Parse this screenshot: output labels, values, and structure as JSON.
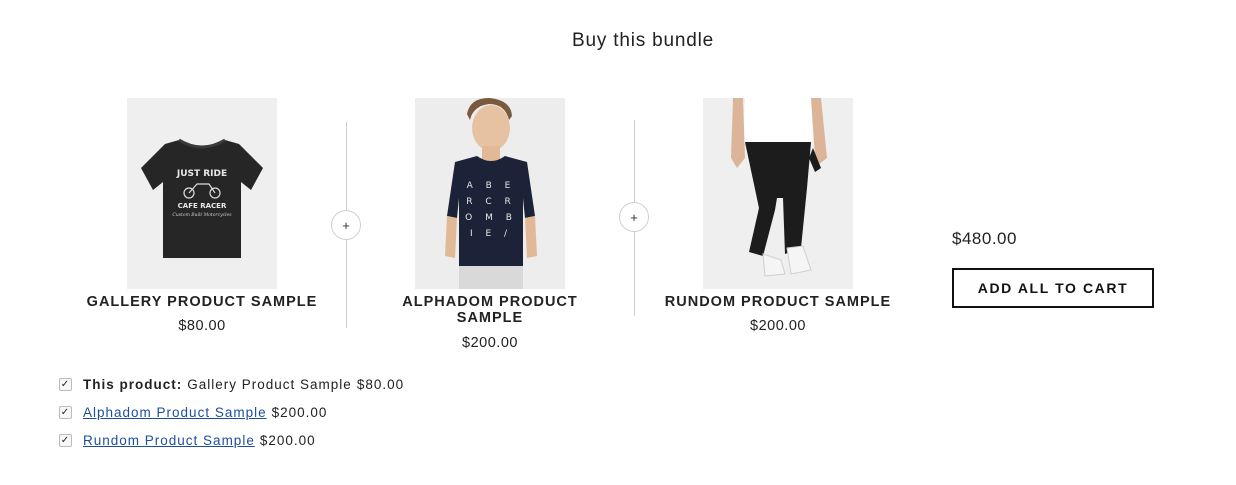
{
  "bundle": {
    "title": "Buy this bundle",
    "plus_symbol": "+",
    "total": "$480.00",
    "add_all_label": "ADD ALL TO CART"
  },
  "products": [
    {
      "name": "GALLERY PRODUCT SAMPLE",
      "price": "$80.00",
      "image": "black-tshirt-image",
      "shirt_text": {
        "line1": "JUST RIDE",
        "line2": "CAFE RACER",
        "line3": "Custom Built Motorcycles"
      }
    },
    {
      "name_line1": "ALPHADOM PRODUCT",
      "name_line2": "SAMPLE",
      "price": "$200.00",
      "image": "model-navy-tshirt-image",
      "shirt_text": "A B E R C R O M B I E"
    },
    {
      "name": "RUNDOM PRODUCT SAMPLE",
      "price": "$200.00",
      "image": "black-joggers-image"
    }
  ],
  "checklist": [
    {
      "checked": true,
      "prefix": "This product:",
      "label": "Gallery Product Sample",
      "price": "$80.00",
      "link": false
    },
    {
      "checked": true,
      "label": "Alphadom Product Sample",
      "price": "$200.00",
      "link": true
    },
    {
      "checked": true,
      "label": "Rundom Product Sample",
      "price": "$200.00",
      "link": true
    }
  ],
  "colors": {
    "link": "#1d4f9c",
    "divider": "#cfcfcf",
    "image_bg": "#eeeeee"
  }
}
